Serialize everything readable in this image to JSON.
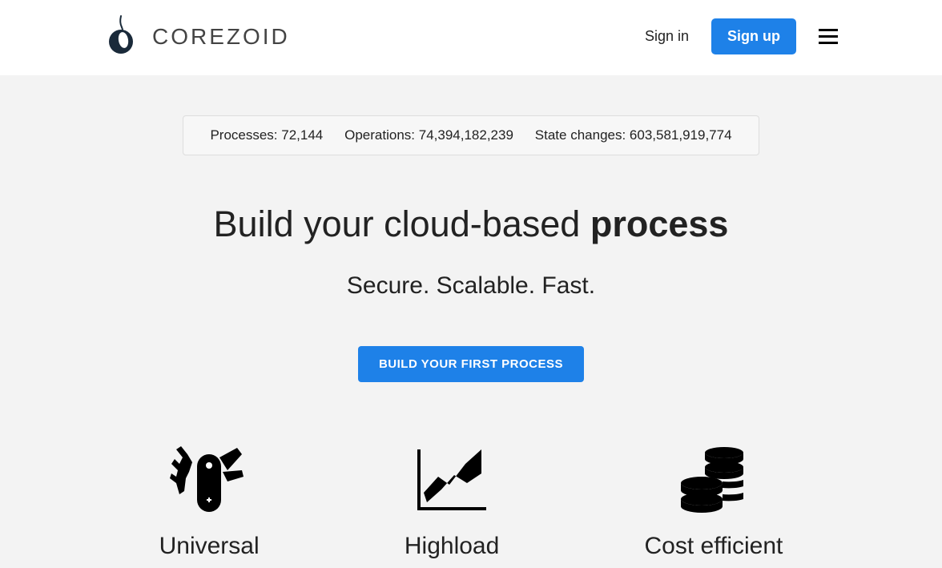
{
  "header": {
    "brand": "COREZOID",
    "signin": "Sign in",
    "signup": "Sign up"
  },
  "stats": {
    "processes_label": "Processes: ",
    "processes_value": "72,144",
    "operations_label": "Operations: ",
    "operations_value": "74,394,182,239",
    "state_changes_label": "State changes: ",
    "state_changes_value": "603,581,919,774"
  },
  "hero": {
    "headline_prefix": "Build your cloud-based ",
    "headline_bold": "process",
    "subhead": "Secure. Scalable. Fast.",
    "cta": "BUILD YOUR FIRST PROCESS"
  },
  "features": [
    {
      "title": "Universal"
    },
    {
      "title": "Highload"
    },
    {
      "title": "Cost efficient"
    }
  ]
}
